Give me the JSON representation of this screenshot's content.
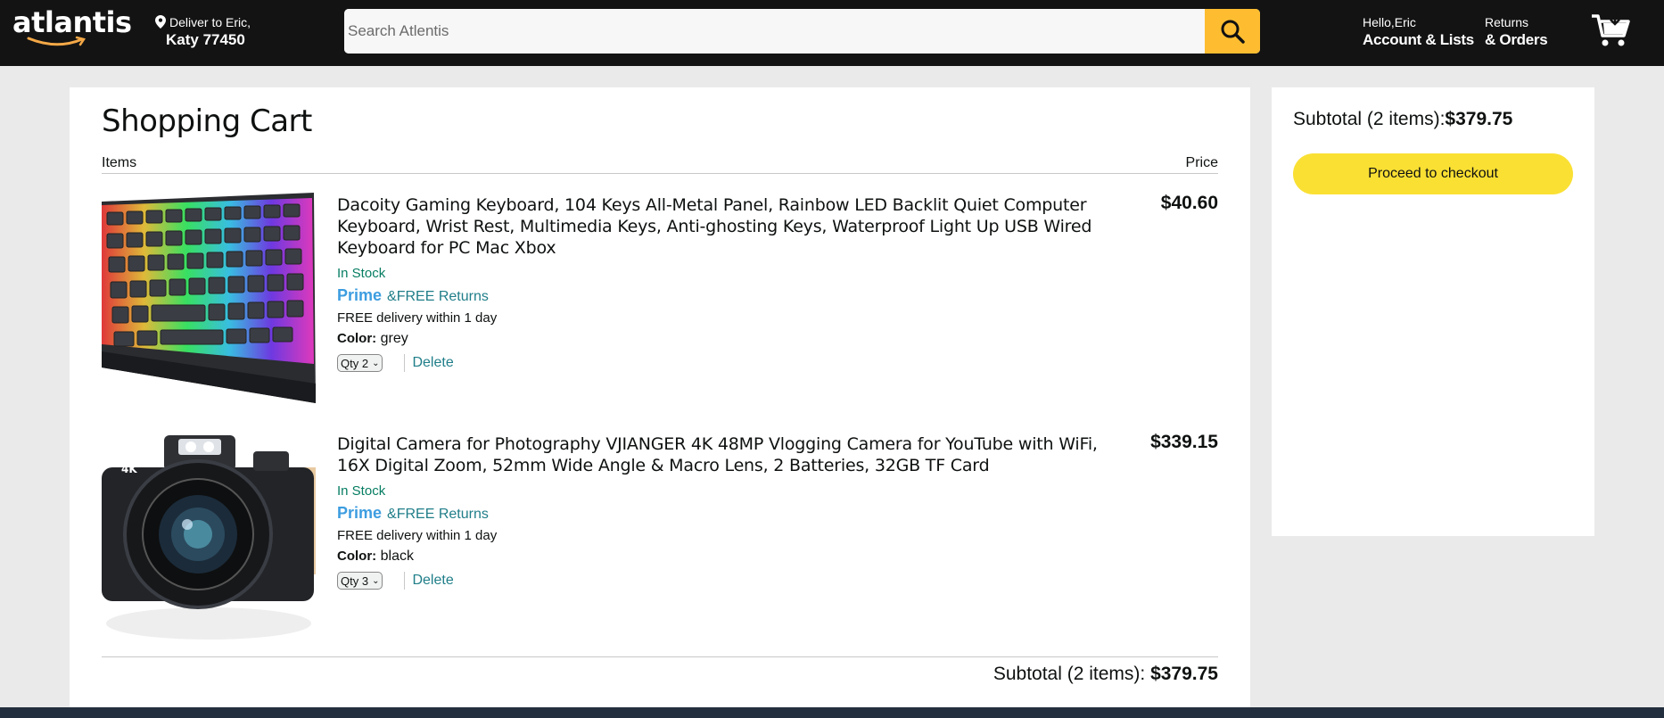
{
  "header": {
    "logo_text": "atlantis",
    "deliver_line1": "Deliver to Eric,",
    "deliver_line2": "Katy 77450",
    "search_placeholder": "Search Atlentis",
    "account_line1": "Hello,Eric",
    "account_line2": "Account & Lists",
    "returns_line1": "Returns",
    "returns_line2": "& Orders"
  },
  "cart": {
    "title": "Shopping Cart",
    "col_items": "Items",
    "col_price": "Price",
    "items": [
      {
        "name": "Dacoity Gaming Keyboard, 104 Keys All-Metal Panel, Rainbow LED Backlit Quiet Computer Keyboard, Wrist Rest, Multimedia Keys, Anti-ghosting Keys, Waterproof Light Up USB Wired Keyboard for PC Mac Xbox",
        "stock": "In Stock",
        "prime": "Prime",
        "free_returns": "&FREE Returns",
        "delivery": "FREE delivery within 1 day",
        "color_label": "Color:",
        "color": "grey",
        "qty": "Qty 2",
        "delete": "Delete",
        "price": "$40.60"
      },
      {
        "name": "Digital Camera for Photography VJIANGER 4K 48MP Vlogging Camera for YouTube with WiFi, 16X Digital Zoom, 52mm Wide Angle & Macro Lens, 2 Batteries, 32GB TF Card",
        "stock": "In Stock",
        "prime": "Prime",
        "free_returns": "&FREE Returns",
        "delivery": "FREE delivery within 1 day",
        "color_label": "Color:",
        "color": "black",
        "qty": "Qty 3",
        "delete": "Delete",
        "price": "$339.15"
      }
    ],
    "subtotal_label": "Subtotal (2 items): ",
    "subtotal_value": "$379.75"
  },
  "side": {
    "subtotal_label": "Subtotal (2 items):",
    "subtotal_value": "$379.75",
    "checkout_label": "Proceed to checkout"
  },
  "colors": {
    "header_bg": "#131313",
    "search_button": "#febd30",
    "checkout_button": "#fae033",
    "prime_blue": "#3d9de0",
    "link_teal": "#207e89",
    "stock_green": "#067d62"
  }
}
